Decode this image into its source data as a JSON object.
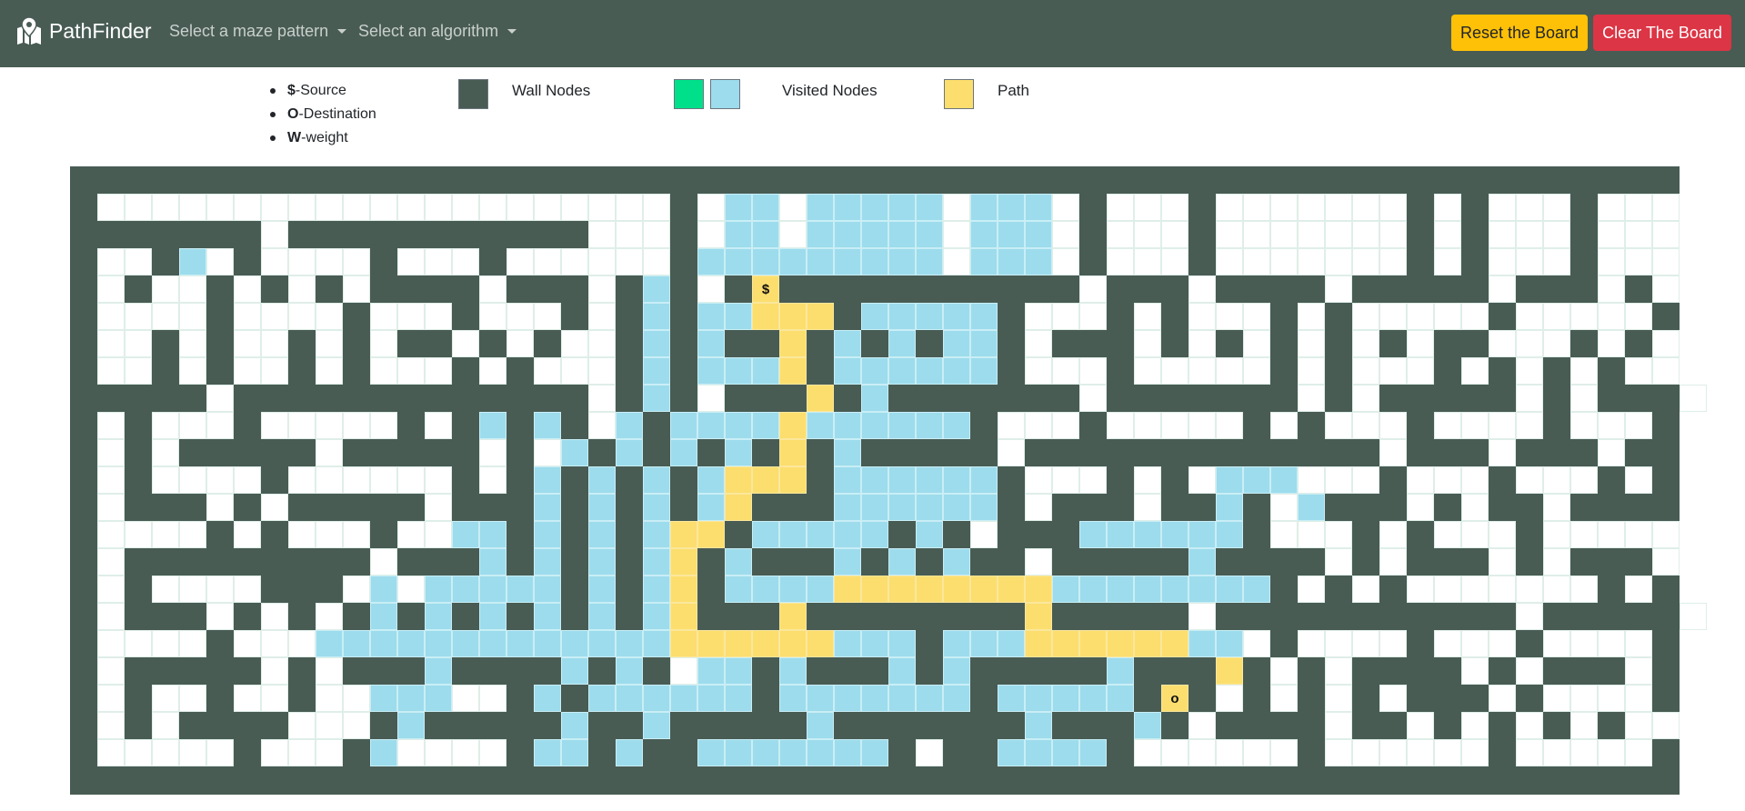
{
  "navbar": {
    "brand": "PathFinder",
    "maze_dropdown": "Select a maze pattern",
    "algorithm_dropdown": "Select an algorithm",
    "reset_button": "Reset the Board",
    "clear_button": "Clear The Board"
  },
  "legend": {
    "items": [
      {
        "symbol": "$",
        "text": "-Source"
      },
      {
        "symbol": "O",
        "text": "-Destination"
      },
      {
        "symbol": "W",
        "text": "-weight"
      }
    ],
    "wall_label": "Wall Nodes",
    "visited_label": "Visited Nodes",
    "path_label": "Path",
    "colors": {
      "wall": "#485c54",
      "visited_a": "#00e08a",
      "visited_b": "#9ddcec",
      "path": "#fcde6e",
      "open": "#ffffff",
      "reset_button": "#ffc107",
      "clear_button": "#dc3545"
    }
  },
  "grid": {
    "rows": 23,
    "cols": 59,
    "source_symbol": "$",
    "destination_symbol": "o",
    "map": [
      "###########################################################",
      "#.....................#.VV.VVVVV.VVV.#...#.......#.#...#...#",
      "#######.###########...#.VV.VVVVV.VVV.#...#.......#.#...#...#",
      "#..#V.#....#...#......#VVVVVVVVV.VVV.#...#.......#.#...#...#",
      "#.#..#.#.#.####.###.#V#.#S###########.###.####.#####.###.#.#",
      "#....#....#...#...#.#V#VVPPP#VVVVV#...#.#...#.#.....#.....#",
      "#..#.#..#.#.##.#.#..#V#V##P#V#V#VV#.###.#.#.#.#.#.##...#.#.#",
      "#..#.#..#.#...#.#...#V#VVVP#VVVVVV#...#.....#.#...#.#.#.#..#",
      "#####.#############.#V#.###P#V#######.#######.#.#####.#.###.",
      "#.#...#.....#.#V#V#.V#VVVVPVVVVVV#...#.....#.#...#....#...#",
      "#.#.#####.#####.#.V#V#V#V#P#V#####.#############.###.###.###",
      "#.#....#......#.#V#V#V#VPPP#VVVVVV#...#.#.VVV...#...#...#.#",
      "#.###.#.#####.###V#V#V#VP###VVVVVV#.###.##V#.V###.#.##.#####",
      "#....#.#...#..VV#V#V#VPP#VVVVV#V#.###VVVVVV#...#.#...#.....#",
      "#.#########.###V#V#V#VP#V###V#V#V##.#####V####.#.###.#.###.#",
      "#.#....###.V.VVVVV#V#VP#VVVVPPPPPPPPVVVVVVVV#.#.#.......#.#",
      "#.###.#.#.#V#V#V#V#V#VP###P########P#####.###########.#####.",
      "#....#...VVVVVVVVVVVVVPPPPPPVVV#VVVPPPPPPVV.#....#...#....#",
      "#.#####.#.###V####V#V#.VV#V###V#V#####V###P#.#.####.#.###.#",
      "#.#..#..#..VVV..#V#VVVVVV#VVVVVVV#VVVVV#O#.#.#.#.###.#....#",
      "#.#.####...#V#####V##V#####V#######V###V#.####.##.#.#.#.#..#",
      "#.....#...#V....#VV#V##VVVVVVV#.##VVVV#......#......#.....#",
      "###########################################################"
    ]
  }
}
